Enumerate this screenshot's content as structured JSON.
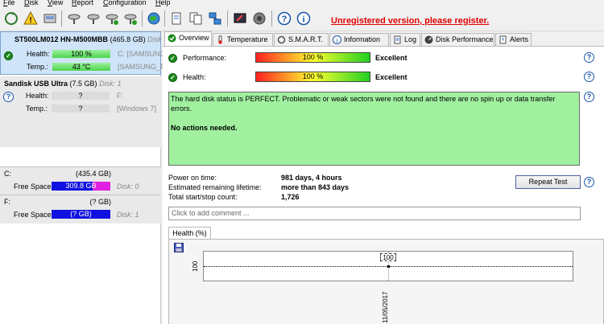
{
  "menu": {
    "items": [
      "File",
      "Disk",
      "View",
      "Report",
      "Configuration",
      "Help"
    ],
    "accel": [
      "F",
      "D",
      "V",
      "R",
      "C",
      "H"
    ],
    "rest": [
      "ile",
      "isk",
      "iew",
      "eport",
      "onfiguration",
      "elp"
    ]
  },
  "toolbar": {
    "unregistered_text": "Unregistered version, please register."
  },
  "disks": [
    {
      "name": "ST500LM012 HN-M500MBB",
      "size": "(465.8 GB)",
      "index_label": "Disk",
      "health_label": "Health:",
      "health_value": "100 %",
      "health_extra": "C:  [SAMSUNG",
      "temp_label": "Temp.:",
      "temp_value": "43 °C",
      "temp_extra": "[SAMSUNG_F"
    },
    {
      "name": "Sandisk USB Ultra",
      "size": "(7.5 GB)",
      "index_label": "Disk: 1",
      "health_label": "Health:",
      "health_value": "?",
      "health_extra": "F:",
      "temp_label": "Temp.:",
      "temp_value": "?",
      "temp_extra": "[Windows 7]"
    }
  ],
  "volumes": [
    {
      "name": "C:",
      "size": "(435.4 GB)",
      "free_label": "Free Space",
      "free_value": "309.8 GB",
      "disk": "Disk: 0"
    },
    {
      "name": "F:",
      "size": "(? GB)",
      "free_label": "Free Space",
      "free_value": "(? GB)",
      "disk": "Disk: 1"
    }
  ],
  "tabs": [
    "Overview",
    "Temperature",
    "S.M.A.R.T.",
    "Information",
    "Log",
    "Disk Performance",
    "Alerts"
  ],
  "overview": {
    "performance_label": "Performance:",
    "performance_value": "100 %",
    "performance_text": "Excellent",
    "performance_level": 1.0,
    "health_label": "Health:",
    "health_value": "100 %",
    "health_text": "Excellent",
    "health_level": 1.0,
    "status_line1": "The hard disk status is PERFECT. Problematic or weak sectors were not found and there are no spin up or data transfer errors.",
    "status_line2": "No actions needed.",
    "power_on_label": "Power on time:",
    "power_on_value": "981 days, 4 hours",
    "remaining_label": "Estimated remaining lifetime:",
    "remaining_value": "more than 843 days",
    "startstop_label": "Total start/stop count:",
    "startstop_value": "1,726",
    "repeat_button": "Repeat Test",
    "comment_placeholder": "Click to add comment ...",
    "chart_tab": "Health (%)"
  },
  "chart_data": {
    "type": "line",
    "x": [
      "11/05/2017"
    ],
    "values": [
      100
    ],
    "y_tick_label": "100",
    "data_label": "100",
    "grid": true
  },
  "colors": {
    "unregistered": "#e00000",
    "status_bg": "#a0f0a0",
    "free_bar": "#1010e0",
    "selected_disk": "#cfe4f8"
  }
}
